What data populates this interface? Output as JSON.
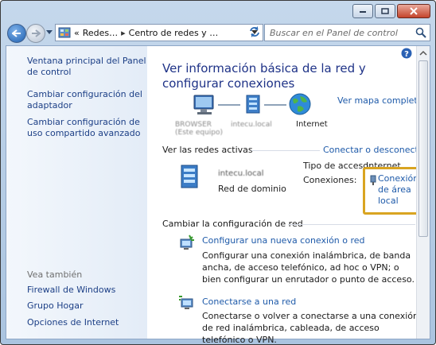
{
  "window": {
    "buttons": [
      "minimize",
      "maximize",
      "close"
    ]
  },
  "address": {
    "crumbs_prefix": "«",
    "crumb1": "Redes…",
    "crumb2": "Centro de redes y …",
    "search_placeholder": "Buscar en el Panel de control"
  },
  "sidebar": {
    "items": [
      {
        "label": "Ventana principal del Panel de control"
      },
      {
        "label": "Cambiar configuración del adaptador"
      },
      {
        "label": "Cambiar configuración de uso compartido avanzado"
      }
    ],
    "see_also_title": "Vea también",
    "see_also": [
      {
        "label": "Firewall de Windows"
      },
      {
        "label": "Grupo Hogar"
      },
      {
        "label": "Opciones de Internet"
      }
    ]
  },
  "main": {
    "title": "Ver información básica de la red y configurar conexiones",
    "map_link": "Ver mapa completo",
    "map": {
      "computer_name": "BROWSER",
      "computer_sub": "(Este equipo)",
      "network_name": "intecu.local",
      "internet_label": "Internet"
    },
    "active_title": "Ver las redes activas",
    "connect_link": "Conectar o desconectar",
    "active_network": {
      "name": "intecu.local",
      "type": "Red de dominio",
      "access_label": "Tipo de acceso:",
      "access_value": "Internet",
      "connections_label": "Conexiones:",
      "connections_value": "Conexión de área local"
    },
    "change_title": "Cambiar la configuración de red",
    "tasks": [
      {
        "title": "Configurar una nueva conexión o red",
        "desc": "Configurar una conexión inalámbrica, de banda ancha, de acceso telefónico, ad hoc o VPN; o bien configurar un enrutador o punto de acceso."
      },
      {
        "title": "Conectarse a una red",
        "desc": "Conectarse o volver a conectarse a una conexión de red inalámbrica, cableada, de acceso telefónico o VPN."
      }
    ]
  },
  "colors": {
    "link": "#1e5aa9",
    "title": "#1e3287",
    "highlight": "#d9a421"
  }
}
